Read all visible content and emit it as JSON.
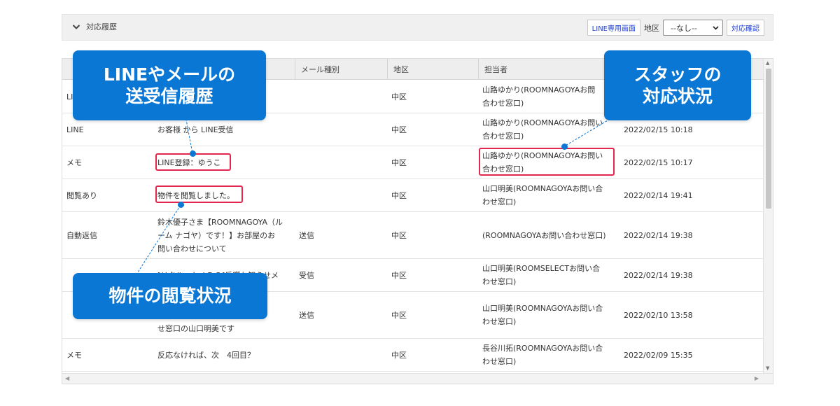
{
  "header": {
    "title": "対応履歴",
    "line_button": "LINE専用画面",
    "region_label": "地区",
    "region_select": "--なし--",
    "confirm_button": "対応確認"
  },
  "table": {
    "columns": [
      "",
      "",
      "メール種別",
      "地区",
      "担当者",
      ""
    ],
    "rows": [
      {
        "type": "LINE",
        "content": "",
        "mail_type": "",
        "district": "中区",
        "staff": "山路ゆかり(ROOMNAGOYAお問\n合わせ窓口)",
        "datetime": ""
      },
      {
        "type": "LINE",
        "content": "お客様 から LINE受信",
        "mail_type": "",
        "district": "中区",
        "staff": "山路ゆかり(ROOMNAGOYAお問い\n合わせ窓口)",
        "datetime": "2022/02/15 10:18"
      },
      {
        "type": "メモ",
        "content": "LINE登録：ゆうこ",
        "mail_type": "",
        "district": "中区",
        "staff": "山路ゆかり(ROOMNAGOYAお問い\n合わせ窓口)",
        "datetime": "2022/02/15 10:17"
      },
      {
        "type": "閲覧あり",
        "content": "物件を閲覧しました。",
        "mail_type": "",
        "district": "中区",
        "staff": "山口明美(ROOMNAGOYAお問い合\nわせ窓口)",
        "datetime": "2022/02/14 19:41"
      },
      {
        "type": "自動返信",
        "content": "鈴木優子さま【ROOMNAGOYA（ル\nーム ナゴヤ）です！】お部屋のお\n問い合わせについて",
        "mail_type": "送信",
        "district": "中区",
        "staff": "(ROOMNAGOYAお問い合わせ窓口)",
        "datetime": "2022/02/14 19:38"
      },
      {
        "type": "",
        "content": "[リクルートＪＤＳ]反響お知らせメ\n",
        "mail_type": "受信",
        "district": "中区",
        "staff": "山口明美(ROOMSELECTお問い合\nわせ窓口)",
        "datetime": "2022/02/14 19:38"
      },
      {
        "type": "",
        "content": "らせく\nい合わ\nせ窓口の山口明美です",
        "mail_type": "送信",
        "district": "中区",
        "staff": "山口明美(ROOMNAGOYAお問い合\nわせ窓口)",
        "datetime": "2022/02/10 13:58"
      },
      {
        "type": "メモ",
        "content": "反応なければ、次　4回目？",
        "mail_type": "",
        "district": "中区",
        "staff": "長谷川拓(ROOMNAGOYAお問い合\nわせ窓口)",
        "datetime": "2022/02/09 15:35"
      }
    ]
  },
  "callouts": {
    "history": [
      "LINEやメールの",
      "送受信履歴"
    ],
    "staff": [
      "スタッフの",
      "対応状況"
    ],
    "viewing": [
      "物件の閲覧状況"
    ]
  },
  "colors": {
    "callout": "#0b77d4",
    "highlight": "#e2264d",
    "link": "#1f3fd1"
  }
}
